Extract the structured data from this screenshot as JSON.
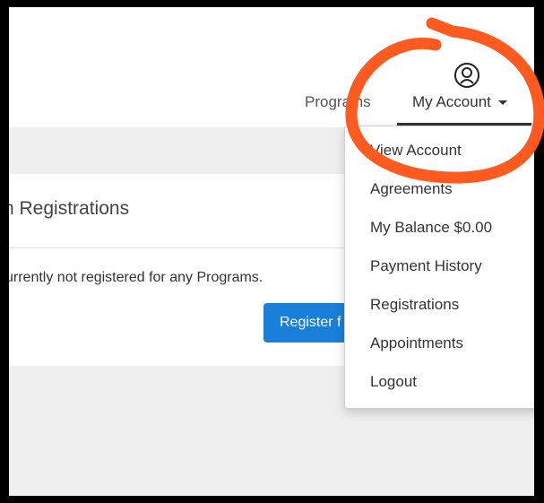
{
  "nav": {
    "programs_label": "Programs",
    "account_label": "My Account"
  },
  "panel": {
    "title": "n Registrations",
    "message": "urrently not registered for any Programs.",
    "register_button": "Register f"
  },
  "account_menu": {
    "items": [
      {
        "label": "View Account"
      },
      {
        "label": "Agreements"
      },
      {
        "label": "My Balance $0.00"
      },
      {
        "label": "Payment History"
      },
      {
        "label": "Registrations"
      },
      {
        "label": "Appointments"
      },
      {
        "label": "Logout"
      }
    ]
  },
  "icons": {
    "user": "user-icon",
    "caret": "caret-down-icon"
  },
  "colors": {
    "primary_button": "#1a7fd8",
    "annotation": "#ff5a1f"
  }
}
